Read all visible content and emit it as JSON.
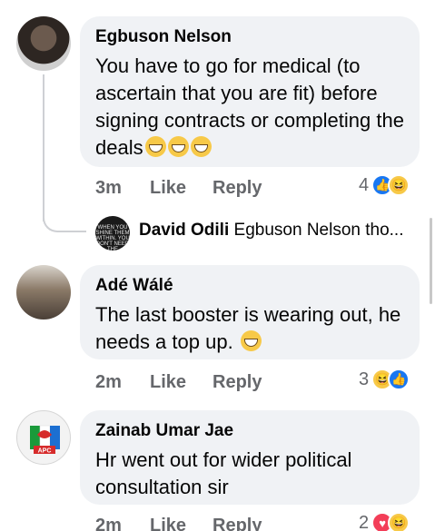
{
  "comments": [
    {
      "author": "Egbuson Nelson",
      "text": "You have to go for medical (to ascertain that you are fit) before signing contracts or completing the deals",
      "time": "3m",
      "like_label": "Like",
      "reply_label": "Reply",
      "reaction_count": "4",
      "reactions": [
        "like-icon",
        "haha-icon"
      ]
    },
    {
      "author": "Adé Wálé",
      "text": "The last booster is wearing out, he needs a top up.",
      "time": "2m",
      "like_label": "Like",
      "reply_label": "Reply",
      "reaction_count": "3",
      "reactions": [
        "haha-icon",
        "like-icon"
      ]
    },
    {
      "author": "Zainab Umar Jae",
      "text": "Hr went out for wider political consultation sir",
      "time": "2m",
      "like_label": "Like",
      "reply_label": "Reply",
      "reaction_count": "2",
      "reactions": [
        "love-icon",
        "haha-icon"
      ]
    }
  ],
  "reply_preview": {
    "author": "David Odili",
    "text": "Egbuson Nelson tho...",
    "avatar_text": "WHEN YOU SHINE THEM WITHIN. YOU DON'T NEED THE SPOTLIGHT"
  },
  "apc_logo_text": "APC",
  "colors": {
    "bubble": "#f0f2f5",
    "meta": "#65676b",
    "like": "#1877f2",
    "love": "#f33e58",
    "haha": "#f7c948"
  }
}
